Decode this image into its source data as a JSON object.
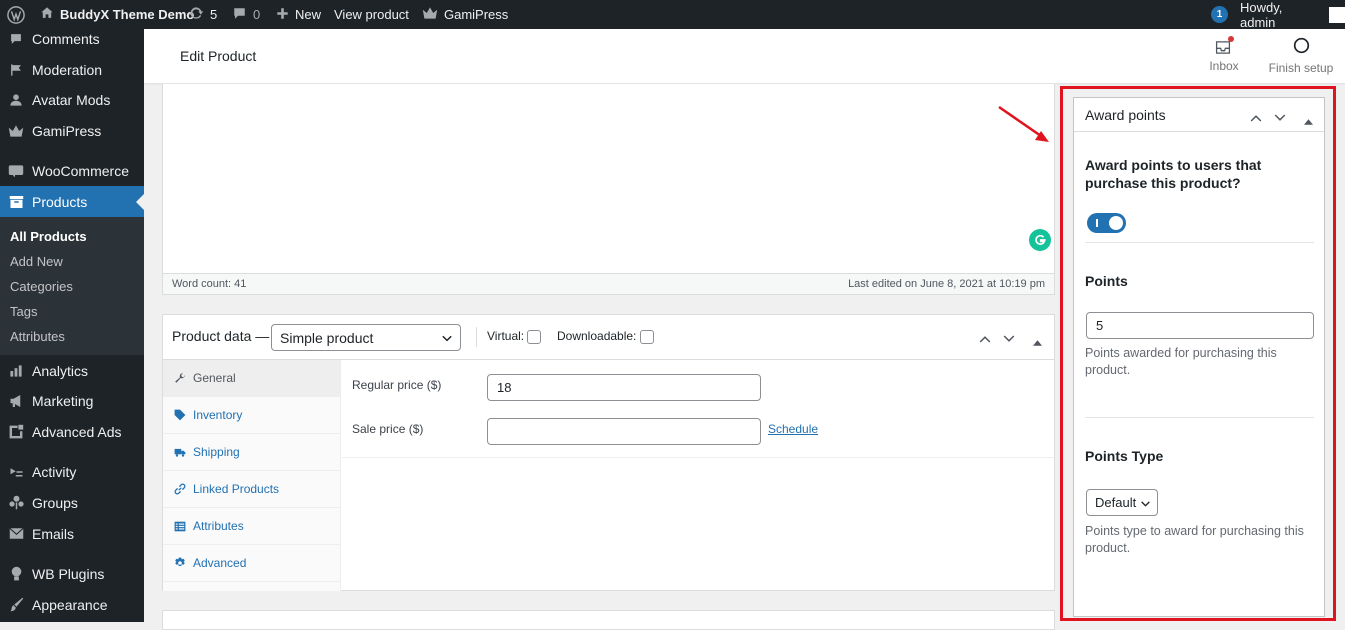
{
  "adminbar": {
    "site_name": "BuddyX Theme Demo",
    "updates_count": "5",
    "comments_count": "0",
    "new_label": "New",
    "view_product": "View product",
    "gamipress": "GamiPress",
    "notif_count": "1",
    "howdy": "Howdy, admin"
  },
  "sidebar": {
    "items": [
      {
        "label": "Comments",
        "icon": "comments-icon"
      },
      {
        "label": "Moderation",
        "icon": "flag-icon"
      },
      {
        "label": "Avatar Mods",
        "icon": "user-icon"
      },
      {
        "label": "GamiPress",
        "icon": "crown-icon"
      },
      {
        "label": "WooCommerce",
        "icon": "woo-icon"
      },
      {
        "label": "Products",
        "icon": "archive-icon"
      },
      {
        "label": "Analytics",
        "icon": "chart-bar-icon"
      },
      {
        "label": "Marketing",
        "icon": "megaphone-icon"
      },
      {
        "label": "Advanced Ads",
        "icon": "ads-icon"
      },
      {
        "label": "Activity",
        "icon": "activity-icon"
      },
      {
        "label": "Groups",
        "icon": "groups-icon"
      },
      {
        "label": "Emails",
        "icon": "email-icon"
      },
      {
        "label": "WB Plugins",
        "icon": "bulb-icon"
      },
      {
        "label": "Appearance",
        "icon": "brush-icon"
      }
    ],
    "submenu": [
      "All Products",
      "Add New",
      "Categories",
      "Tags",
      "Attributes"
    ]
  },
  "header": {
    "title": "Edit Product",
    "inbox": "Inbox",
    "finish_setup": "Finish setup"
  },
  "editor": {
    "word_count": "Word count: 41",
    "last_edited": "Last edited on June 8, 2021 at 10:19 pm"
  },
  "product_data": {
    "label": "Product data —",
    "type_selected": "Simple product",
    "virtual": "Virtual:",
    "downloadable": "Downloadable:",
    "tabs": [
      "General",
      "Inventory",
      "Shipping",
      "Linked Products",
      "Attributes",
      "Advanced"
    ],
    "regular_price_label": "Regular price ($)",
    "regular_price_value": "18",
    "sale_price_label": "Sale price ($)",
    "sale_price_value": "",
    "schedule": "Schedule"
  },
  "award_points": {
    "title": "Award points",
    "question": "Award points to users that purchase this product?",
    "toggle_on": true,
    "points_label": "Points",
    "points_value": "5",
    "points_desc": "Points awarded for purchasing this product.",
    "type_label": "Points Type",
    "type_selected": "Default",
    "type_desc": "Points type to award for purchasing this product."
  },
  "colors": {
    "accent": "#2271b1",
    "highlight": "#e0141e",
    "toggle": "#2271b1"
  }
}
